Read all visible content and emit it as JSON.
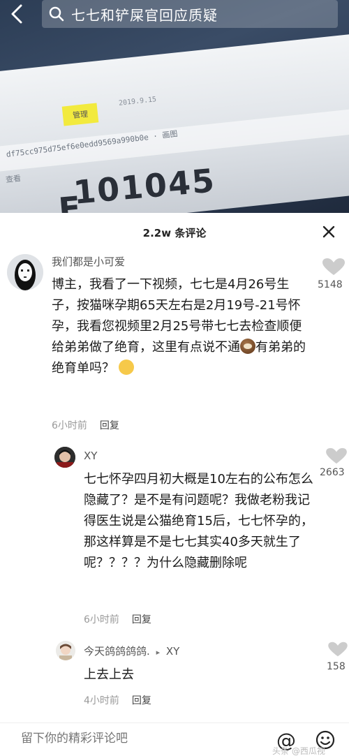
{
  "search": {
    "query": "七七和铲屎官回应质疑"
  },
  "video": {
    "tag": "管理",
    "date": "2019.9.15",
    "hash": "df75cc975d75ef6e0edd9569a990b0e · 画图",
    "small_label": "查看",
    "big_number": "101045",
    "big_prefix": "E"
  },
  "sheet": {
    "title": "2.2w 条评论"
  },
  "comments": [
    {
      "author": "我们都是小可爱",
      "text_main": "博主，我看了一下视频，七七是4月26号生子，按猫咪孕期65天左右是2月19号-21号怀孕，我看您视频里2月25号带七七去检查顺便给弟弟做了绝育，这里有点说不通",
      "text_tail": "有弟弟的绝育单吗？",
      "time": "6小时前",
      "reply_label": "回复",
      "likes": "5148"
    },
    {
      "author": "XY",
      "text": "七七怀孕四月初大概是10左右的公布怎么隐藏了？是不是有问题呢？我做老粉我记得医生说是公猫绝育15后，七七怀孕的，那这样算是不是七七其实40多天就生了呢？？？？为什么隐藏删除呢",
      "time": "6小时前",
      "reply_label": "回复",
      "likes": "2663"
    },
    {
      "author": "今天鸽鸽鸽鸽.",
      "reply_to": "XY",
      "text": "上去上去",
      "time": "4小时前",
      "reply_label": "回复",
      "likes": "158"
    }
  ],
  "footer": {
    "placeholder": "留下你的精彩评论吧",
    "at_symbol": "@"
  },
  "watermark": "头条 @西瓜视",
  "colors": {
    "accent_tag": "#f2ea3e",
    "text_primary": "#1a1a1a",
    "text_meta": "#999999"
  }
}
